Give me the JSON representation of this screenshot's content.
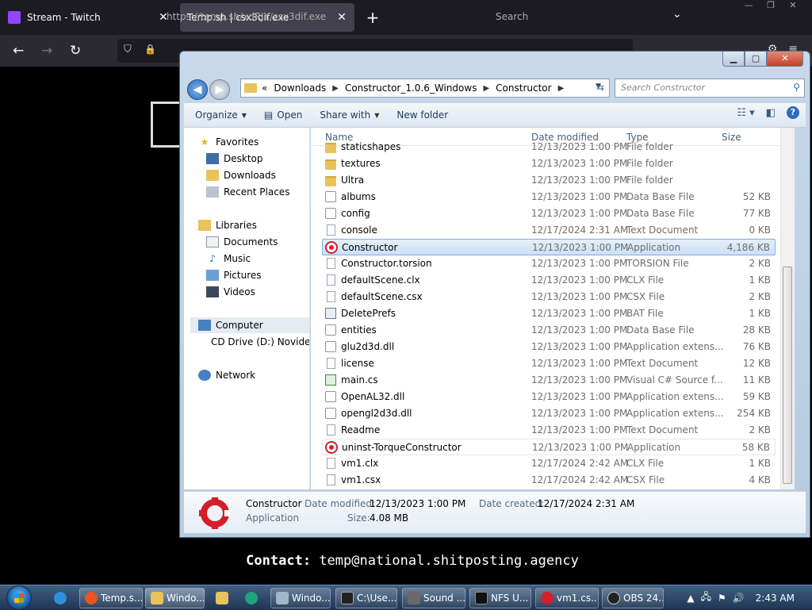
{
  "browser": {
    "tabs": [
      {
        "title": "Stream - Twitch",
        "active": false,
        "close": "✕"
      },
      {
        "title": "Temp.sh | csx3dif.exe",
        "active": true,
        "close": "✕"
      }
    ],
    "new_tab": "+",
    "url_text": "https://temp.sh/xdRJY/csx3dif.exe",
    "search_placeholder": "Search",
    "contact_label": "Contact:",
    "contact_email": "temp@national.shitposting.agency"
  },
  "explorer": {
    "breadcrumb": [
      "«",
      "Downloads",
      "Constructor_1.0.6_Windows",
      "Constructor"
    ],
    "search_placeholder": "Search Constructor",
    "toolbar": {
      "organize": "Organize",
      "open": "Open",
      "share_with": "Share with",
      "new_folder": "New folder"
    },
    "nav": {
      "favorites": "Favorites",
      "desktop": "Desktop",
      "downloads": "Downloads",
      "recent": "Recent Places",
      "libraries": "Libraries",
      "documents": "Documents",
      "music": "Music",
      "pictures": "Pictures",
      "videos": "Videos",
      "computer": "Computer",
      "cd_drive": "CD Drive (D:) Novide",
      "network": "Network"
    },
    "columns": {
      "name": "Name",
      "date": "Date modified",
      "type": "Type",
      "size": "Size"
    },
    "files": [
      {
        "name": "staticshapes",
        "date": "12/13/2023 1:00 PM",
        "type": "File folder",
        "size": "",
        "icon": "folder-icon"
      },
      {
        "name": "textures",
        "date": "12/13/2023 1:00 PM",
        "type": "File folder",
        "size": "",
        "icon": "folder-icon"
      },
      {
        "name": "Ultra",
        "date": "12/13/2023 1:00 PM",
        "type": "File folder",
        "size": "",
        "icon": "folder-icon"
      },
      {
        "name": "albums",
        "date": "12/13/2023 1:00 PM",
        "type": "Data Base File",
        "size": "52 KB",
        "icon": "gear-file-icon"
      },
      {
        "name": "config",
        "date": "12/13/2023 1:00 PM",
        "type": "Data Base File",
        "size": "77 KB",
        "icon": "gear-file-icon"
      },
      {
        "name": "console",
        "date": "12/17/2024 2:31 AM",
        "type": "Text Document",
        "size": "0 KB",
        "icon": "document-icon"
      },
      {
        "name": "Constructor",
        "date": "12/13/2023 1:00 PM",
        "type": "Application",
        "size": "4,186 KB",
        "icon": "application-icon"
      },
      {
        "name": "Constructor.torsion",
        "date": "12/13/2023 1:00 PM",
        "type": "TORSION File",
        "size": "2 KB",
        "icon": "document-icon"
      },
      {
        "name": "defaultScene.clx",
        "date": "12/13/2023 1:00 PM",
        "type": "CLX File",
        "size": "1 KB",
        "icon": "document-icon"
      },
      {
        "name": "defaultScene.csx",
        "date": "12/13/2023 1:00 PM",
        "type": "CSX File",
        "size": "2 KB",
        "icon": "document-icon"
      },
      {
        "name": "DeletePrefs",
        "date": "12/13/2023 1:00 PM",
        "type": "BAT File",
        "size": "1 KB",
        "icon": "batch-file-icon"
      },
      {
        "name": "entities",
        "date": "12/13/2023 1:00 PM",
        "type": "Data Base File",
        "size": "28 KB",
        "icon": "gear-file-icon"
      },
      {
        "name": "glu2d3d.dll",
        "date": "12/13/2023 1:00 PM",
        "type": "Application extens...",
        "size": "76 KB",
        "icon": "gear-file-icon"
      },
      {
        "name": "license",
        "date": "12/13/2023 1:00 PM",
        "type": "Text Document",
        "size": "12 KB",
        "icon": "document-icon"
      },
      {
        "name": "main.cs",
        "date": "12/13/2023 1:00 PM",
        "type": "Visual C# Source f...",
        "size": "11 KB",
        "icon": "csharp-file-icon"
      },
      {
        "name": "OpenAL32.dll",
        "date": "12/13/2023 1:00 PM",
        "type": "Application extens...",
        "size": "59 KB",
        "icon": "gear-file-icon"
      },
      {
        "name": "opengl2d3d.dll",
        "date": "12/13/2023 1:00 PM",
        "type": "Application extens...",
        "size": "254 KB",
        "icon": "gear-file-icon"
      },
      {
        "name": "Readme",
        "date": "12/13/2023 1:00 PM",
        "type": "Text Document",
        "size": "2 KB",
        "icon": "document-icon"
      },
      {
        "name": "uninst-TorqueConstructor",
        "date": "12/13/2023 1:00 PM",
        "type": "Application",
        "size": "58 KB",
        "icon": "application-icon"
      },
      {
        "name": "vm1.clx",
        "date": "12/17/2024 2:42 AM",
        "type": "CLX File",
        "size": "1 KB",
        "icon": "document-icon"
      },
      {
        "name": "vm1.csx",
        "date": "12/17/2024 2:42 AM",
        "type": "CSX File",
        "size": "4 KB",
        "icon": "document-icon"
      }
    ],
    "details": {
      "name": "Constructor",
      "type": "Application",
      "date_modified_label": "Date modified:",
      "date_modified": "12/13/2023 1:00 PM",
      "date_created_label": "Date created:",
      "date_created": "12/17/2024 2:31 AM",
      "size_label": "Size:",
      "size": "4.08 MB"
    }
  },
  "taskbar": {
    "buttons": [
      "Temp.s...",
      "Windo...",
      "Windo...",
      "C:\\Use...",
      "Sound ...",
      "NFS U...",
      "vm1.cs...",
      "OBS 24..."
    ],
    "clock": "2:43 AM"
  }
}
